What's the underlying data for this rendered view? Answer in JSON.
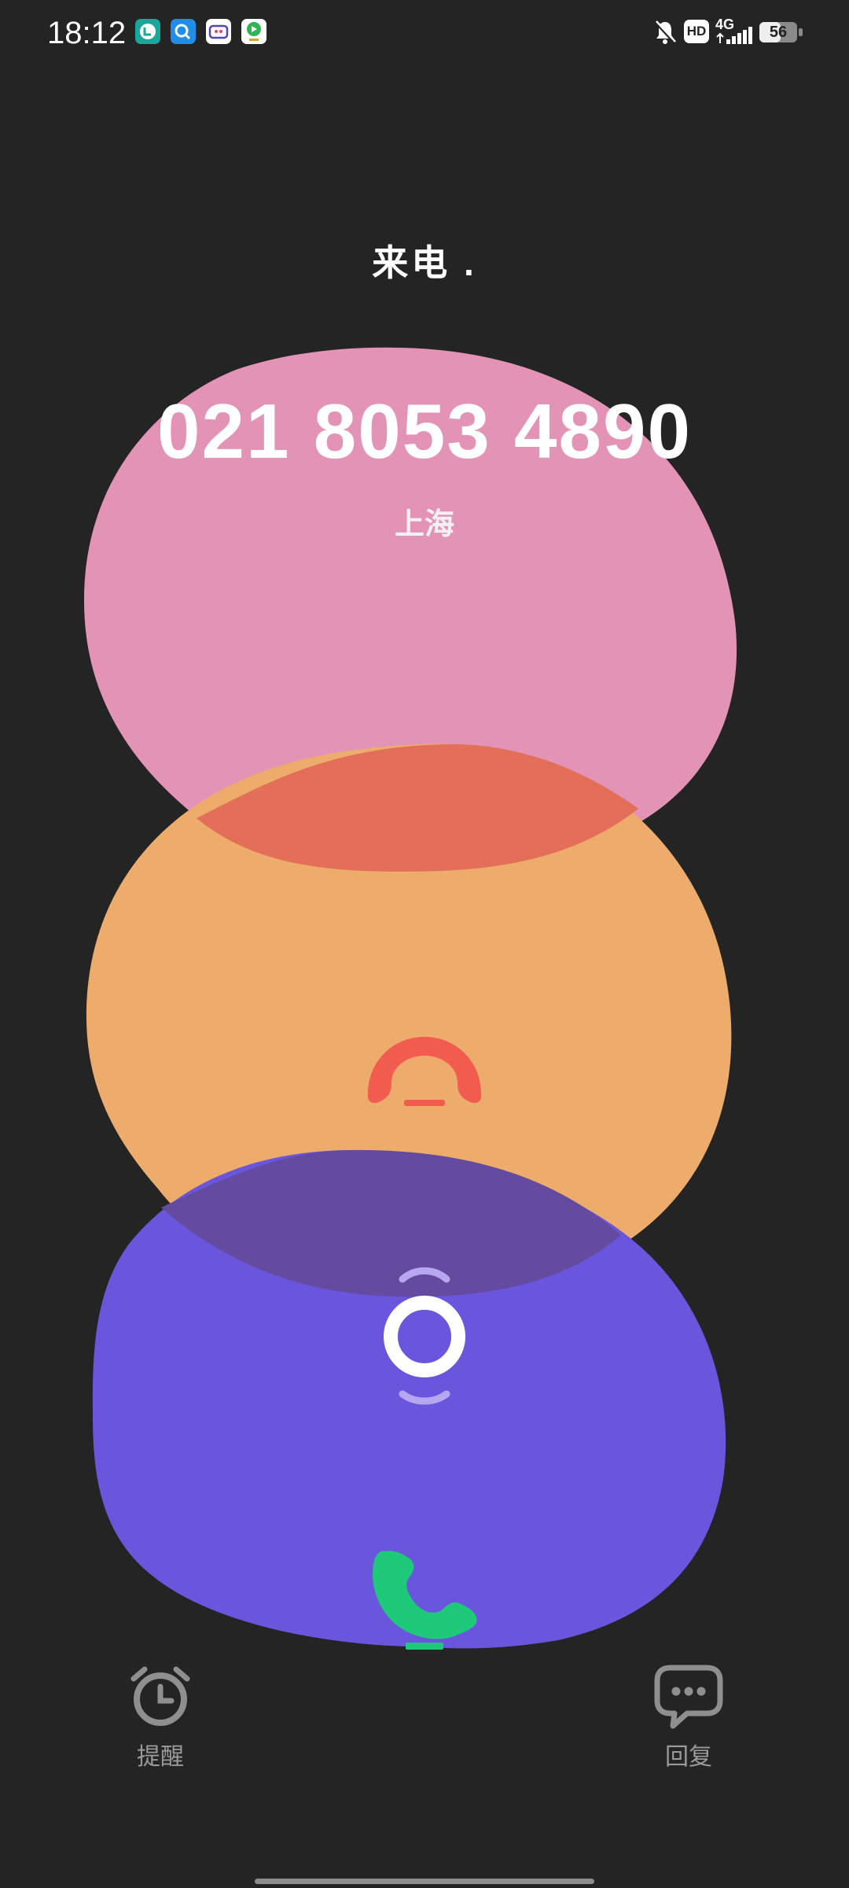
{
  "status_bar": {
    "time": "18:12",
    "app_icons": [
      "chat-app-icon",
      "search-app-icon",
      "video-app-icon",
      "player-app-icon"
    ],
    "indicators": {
      "silent_icon": "bell-off-icon",
      "hd": "HD",
      "network": "4G",
      "battery": "56"
    }
  },
  "call": {
    "status": "来电 .",
    "number": "021 8053 4890",
    "location": "上海"
  },
  "controls": {
    "decline_icon": "hang-up-icon",
    "slider_icon": "swipe-handle-icon",
    "answer_icon": "phone-answer-icon"
  },
  "actions": {
    "remind_label": "提醒",
    "reply_label": "回复"
  },
  "colors": {
    "background": "#232423",
    "pink_blob": "#E393B5",
    "orange_blob": "#EEAC6C",
    "purple_blob": "#6A55DD",
    "decline": "#F25C50",
    "answer": "#1EC97A"
  }
}
